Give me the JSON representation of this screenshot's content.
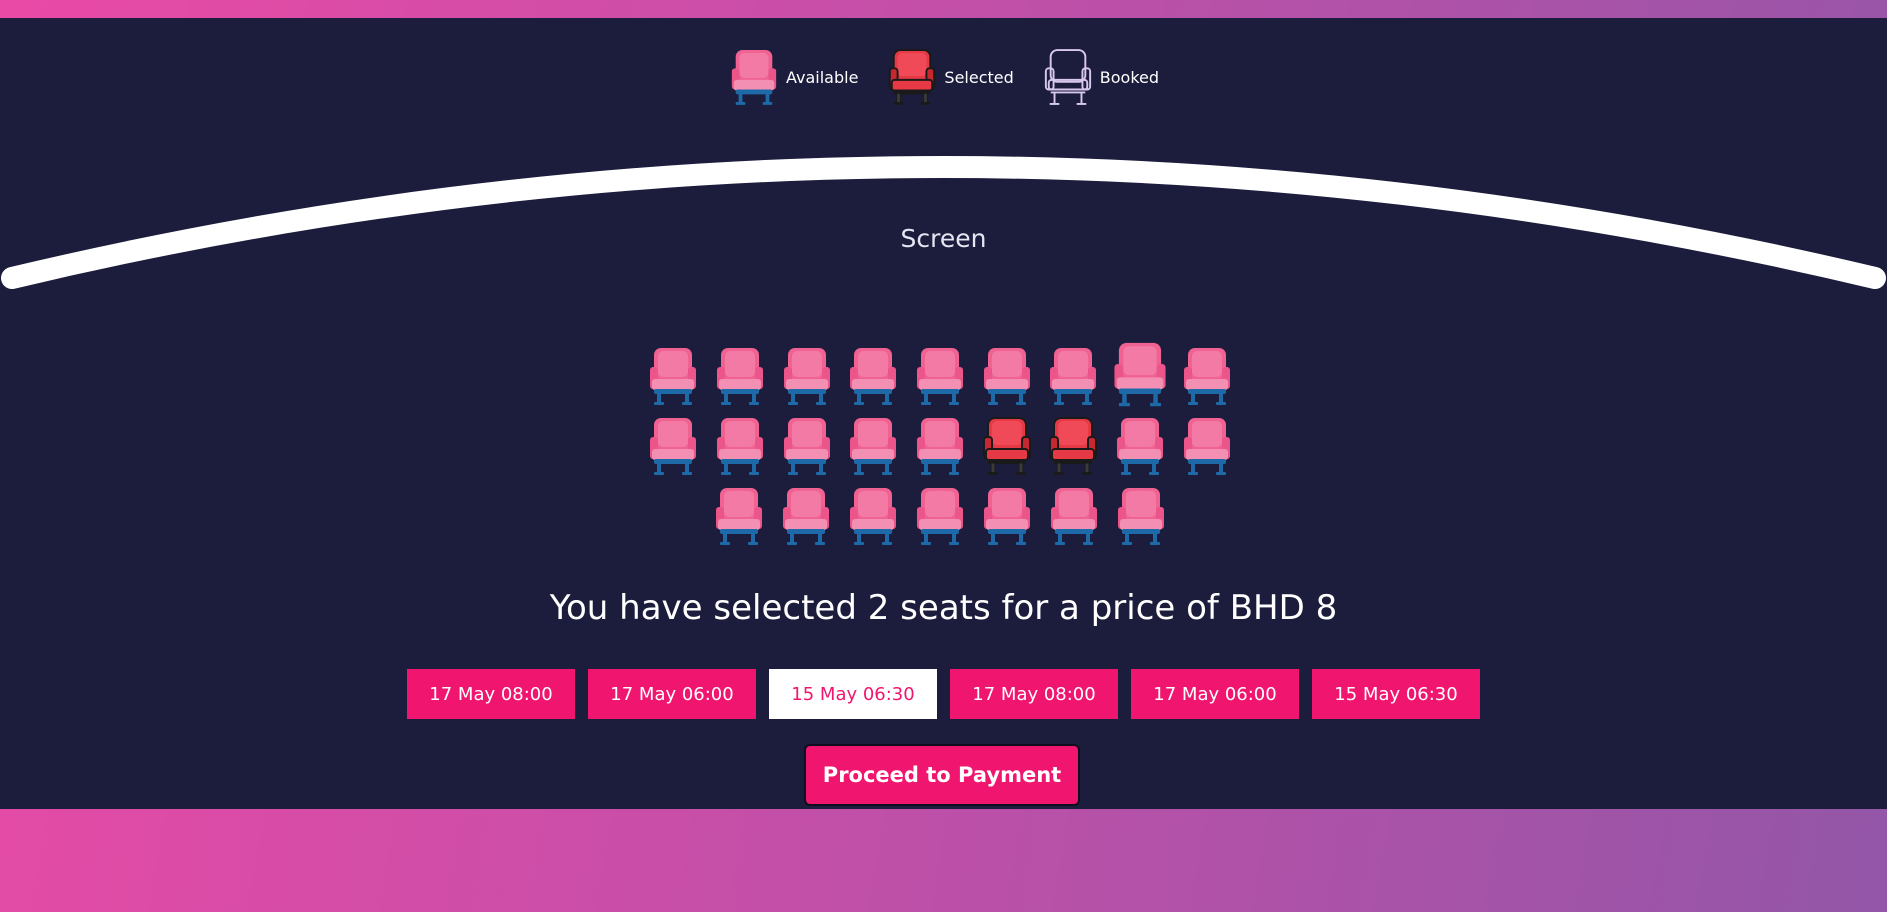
{
  "legend": {
    "available_label": "Available",
    "selected_label": "Selected",
    "booked_label": "Booked"
  },
  "screen": {
    "label": "Screen"
  },
  "seats": {
    "rows": [
      [
        "available",
        "available",
        "available",
        "available",
        "available",
        "available",
        "available",
        "available",
        "available"
      ],
      [
        "available",
        "available",
        "available",
        "available",
        "available",
        "selected",
        "selected",
        "available",
        "available"
      ],
      [
        "available",
        "available",
        "available",
        "available",
        "available",
        "available",
        "available"
      ]
    ]
  },
  "summary": {
    "prefix": "You have selected ",
    "count": "2",
    "middle": " seats for a price of ",
    "currency": "BHD",
    "price": "8"
  },
  "showtimes": [
    {
      "label": "17 May 08:00",
      "active": false
    },
    {
      "label": "17 May 06:00",
      "active": false
    },
    {
      "label": "15 May 06:30",
      "active": true
    },
    {
      "label": "17 May 08:00",
      "active": false
    },
    {
      "label": "17 May 06:00",
      "active": false
    },
    {
      "label": "15 May 06:30",
      "active": false
    }
  ],
  "payment": {
    "button_label": "Proceed to Payment"
  },
  "colors": {
    "panel_bg": "#1c1c3c",
    "accent": "#f0166f",
    "seat_available": "#f06292",
    "seat_selected": "#e53945",
    "seat_booked_outline": "#d8c8ee",
    "seat_legs": "#1e6aa8"
  }
}
